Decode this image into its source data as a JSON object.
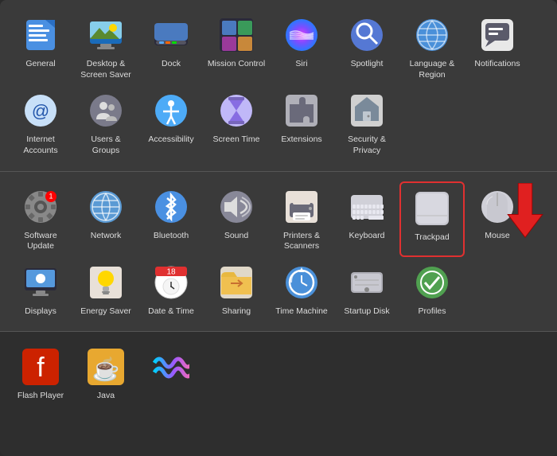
{
  "sections": [
    {
      "id": "section1",
      "rows": [
        {
          "items": [
            {
              "id": "general",
              "label": "General",
              "icon": "general"
            },
            {
              "id": "desktop-screensaver",
              "label": "Desktop &\nScreen Saver",
              "icon": "desktop"
            },
            {
              "id": "dock",
              "label": "Dock",
              "icon": "dock"
            },
            {
              "id": "mission-control",
              "label": "Mission\nControl",
              "icon": "mission"
            },
            {
              "id": "siri",
              "label": "Siri",
              "icon": "siri"
            },
            {
              "id": "spotlight",
              "label": "Spotlight",
              "icon": "spotlight"
            },
            {
              "id": "language-region",
              "label": "Language\n& Region",
              "icon": "language"
            },
            {
              "id": "notifications",
              "label": "Notifications",
              "icon": "notifications"
            }
          ]
        },
        {
          "items": [
            {
              "id": "internet-accounts",
              "label": "Internet\nAccounts",
              "icon": "internet"
            },
            {
              "id": "users-groups",
              "label": "Users &\nGroups",
              "icon": "users"
            },
            {
              "id": "accessibility",
              "label": "Accessibility",
              "icon": "accessibility"
            },
            {
              "id": "screen-time",
              "label": "Screen Time",
              "icon": "screentime"
            },
            {
              "id": "extensions",
              "label": "Extensions",
              "icon": "extensions"
            },
            {
              "id": "security-privacy",
              "label": "Security\n& Privacy",
              "icon": "security"
            }
          ]
        }
      ]
    },
    {
      "id": "section2",
      "rows": [
        {
          "items": [
            {
              "id": "software-update",
              "label": "Software\nUpdate",
              "icon": "softwareupdate",
              "badge": true
            },
            {
              "id": "network",
              "label": "Network",
              "icon": "network"
            },
            {
              "id": "bluetooth",
              "label": "Bluetooth",
              "icon": "bluetooth"
            },
            {
              "id": "sound",
              "label": "Sound",
              "icon": "sound"
            },
            {
              "id": "printers-scanners",
              "label": "Printers &\nScanners",
              "icon": "printers"
            },
            {
              "id": "keyboard",
              "label": "Keyboard",
              "icon": "keyboard"
            },
            {
              "id": "trackpad",
              "label": "Trackpad",
              "icon": "trackpad",
              "highlighted": true
            },
            {
              "id": "mouse",
              "label": "Mouse",
              "icon": "mouse"
            }
          ]
        },
        {
          "items": [
            {
              "id": "displays",
              "label": "Displays",
              "icon": "displays"
            },
            {
              "id": "energy-saver",
              "label": "Energy\nSaver",
              "icon": "energy"
            },
            {
              "id": "date-time",
              "label": "Date & Time",
              "icon": "datetime"
            },
            {
              "id": "sharing",
              "label": "Sharing",
              "icon": "sharing"
            },
            {
              "id": "time-machine",
              "label": "Time\nMachine",
              "icon": "timemachine"
            },
            {
              "id": "startup-disk",
              "label": "Startup\nDisk",
              "icon": "startupdisk"
            },
            {
              "id": "profiles",
              "label": "Profiles",
              "icon": "profiles"
            }
          ]
        }
      ]
    },
    {
      "id": "section3",
      "rows": [
        {
          "items": [
            {
              "id": "flash-player",
              "label": "Flash Player",
              "icon": "flash"
            },
            {
              "id": "java",
              "label": "Java",
              "icon": "java"
            },
            {
              "id": "navi",
              "label": "",
              "icon": "navi"
            }
          ]
        }
      ]
    }
  ]
}
